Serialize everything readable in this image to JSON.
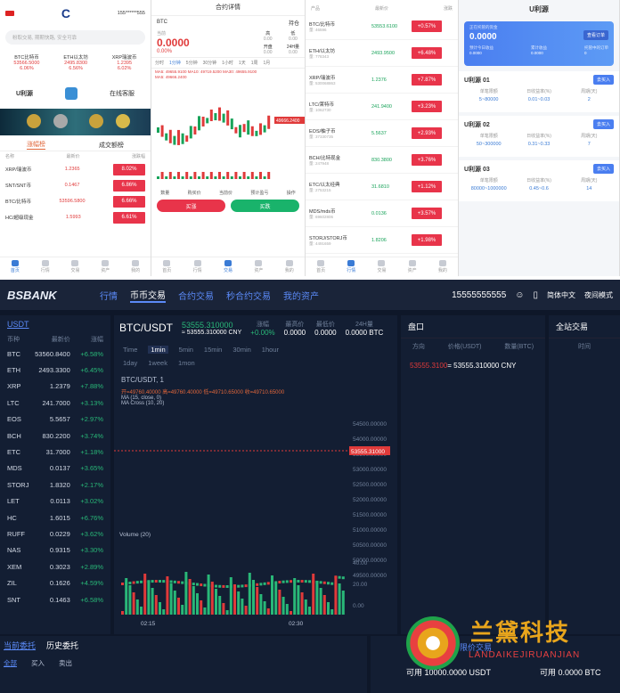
{
  "p1": {
    "logo": "C",
    "phone": "155******555",
    "search": "粉取交易, 期期快路, 安全可靠",
    "ticker": [
      {
        "name": "BTC比特币",
        "price": "53566.5000",
        "chg": "6.06%"
      },
      {
        "name": "ETH以太坊",
        "price": "2495.8300",
        "chg": "6.56%"
      },
      {
        "name": "XRP瑞波币",
        "price": "1.2395",
        "chg": "6.02%"
      }
    ],
    "u_label": "U利源",
    "service": "在线客服",
    "tab_up": "涨幅榜",
    "tab_vol": "成交额榜",
    "col_name": "名称",
    "col_price": "最新价",
    "col_chg": "涨跌幅",
    "rows": [
      {
        "n": "XRP/瑞波币",
        "p": "1.2365",
        "c": "8.02%"
      },
      {
        "n": "SNT/SNT币",
        "p": "0.1467",
        "c": "6.86%"
      },
      {
        "n": "BTC/比特币",
        "p": "53596.5800",
        "c": "6.66%"
      },
      {
        "n": "HC/超级现金",
        "p": "1.5993",
        "c": "6.61%"
      }
    ],
    "tabs": [
      "首页",
      "行情",
      "交易",
      "资产",
      "我的"
    ]
  },
  "p2": {
    "title": "合约详情",
    "sym": "BTC",
    "follow": "持仓",
    "last_label": "当前",
    "price": "0.0000",
    "chg": "0.00%",
    "high_l": "高",
    "high": "0.00",
    "low_l": "低",
    "low": "0.00",
    "open_l": "开盘",
    "open": "0.00",
    "vol_l": "24H量",
    "vol": "0.00",
    "intervals": [
      "分时",
      "1分钟",
      "5分钟",
      "30分钟",
      "1小时",
      "1天",
      "1周",
      "1月"
    ],
    "ma": "MA5: 49655.9100  MA10: 49719.5200  MA30: 49655.9100",
    "ma2": "MA5: 49666.2400",
    "stats": [
      "数量",
      "购买价",
      "当前价",
      "预计盈亏",
      "操作"
    ],
    "buy": "买涨",
    "sell": "买跌",
    "cur_price": "49666.2400"
  },
  "p3": {
    "h_prod": "产品",
    "h_price": "最新价",
    "h_chg": "涨跌",
    "rows": [
      {
        "n": "BTC/比特币",
        "v": "量: 46596",
        "p": "53553.6100",
        "c": "+0.57%"
      },
      {
        "n": "ETH/以太坊",
        "v": "量: 778343",
        "p": "2493.9500",
        "c": "+6.48%"
      },
      {
        "n": "XRP/瑞波币",
        "v": "量: 530068863",
        "p": "1.2376",
        "c": "+7.87%"
      },
      {
        "n": "LTC/莱特币",
        "v": "量: 1062730",
        "p": "241.9400",
        "c": "+3.23%"
      },
      {
        "n": "EOS/柚子币",
        "v": "量: 37330735",
        "p": "5.5637",
        "c": "+2.93%"
      },
      {
        "n": "BCH/比特现金",
        "v": "量: 247948",
        "p": "830.3800",
        "c": "+3.76%"
      },
      {
        "n": "ETC/以太经典",
        "v": "量: 2753215",
        "p": "31.6810",
        "c": "+1.12%"
      },
      {
        "n": "MDS/mds币",
        "v": "量: 69602806",
        "p": "0.0136",
        "c": "+3.57%"
      },
      {
        "n": "STORJ/STORJ币",
        "v": "量: 4491659",
        "p": "1.8206",
        "c": "+1.98%"
      },
      {
        "n": "LET/领导链",
        "v": "量: 124325759",
        "p": "0.0112",
        "c": "+2.44%"
      }
    ]
  },
  "p4": {
    "title": "U利源",
    "card_lbl": "正在托管的资金",
    "card_val": "0.0000",
    "card_btn": "查看订单",
    "s1_l": "预计今日收益",
    "s1": "0.0000",
    "s2_l": "累计收益",
    "s2": "0.0000",
    "s3_l": "托管中的订单",
    "s3": "0",
    "items": [
      {
        "t": "U利源 01",
        "btn": "去买入",
        "g": [
          "单笔限额",
          "日收益率(%)",
          "周期(天)"
        ],
        "v": [
          "5~80000",
          "0.01~0.03",
          "2"
        ]
      },
      {
        "t": "U利源 02",
        "btn": "去买入",
        "g": [
          "单笔限额",
          "日收益率(%)",
          "周期(天)"
        ],
        "v": [
          "50~300000",
          "0.31~0.33",
          "7"
        ]
      },
      {
        "t": "U利源 03",
        "btn": "去买入",
        "g": [
          "单笔限额",
          "日收益率(%)",
          "周期(天)"
        ],
        "v": [
          "80000~1000000",
          "0.45~0.6",
          "14"
        ]
      }
    ]
  },
  "desk": {
    "logo": "BSBANK",
    "nav": [
      "行情",
      "币币交易",
      "合约交易",
      "秒合约交易",
      "我的资产"
    ],
    "phone": "15555555555",
    "lang": "简体中文",
    "mode": "夜间模式",
    "left_title": "USDT",
    "lh": [
      "币种",
      "最新价",
      "涨幅"
    ],
    "list": [
      {
        "s": "BTC",
        "p": "53560.8400",
        "c": "+6.58%"
      },
      {
        "s": "ETH",
        "p": "2493.3300",
        "c": "+6.45%"
      },
      {
        "s": "XRP",
        "p": "1.2379",
        "c": "+7.88%"
      },
      {
        "s": "LTC",
        "p": "241.7000",
        "c": "+3.13%"
      },
      {
        "s": "EOS",
        "p": "5.5657",
        "c": "+2.97%"
      },
      {
        "s": "BCH",
        "p": "830.2200",
        "c": "+3.74%"
      },
      {
        "s": "ETC",
        "p": "31.7000",
        "c": "+1.18%"
      },
      {
        "s": "MDS",
        "p": "0.0137",
        "c": "+3.65%"
      },
      {
        "s": "STORJ",
        "p": "1.8320",
        "c": "+2.17%"
      },
      {
        "s": "LET",
        "p": "0.0113",
        "c": "+3.02%"
      },
      {
        "s": "HC",
        "p": "1.6015",
        "c": "+6.76%"
      },
      {
        "s": "RUFF",
        "p": "0.0229",
        "c": "+3.62%"
      },
      {
        "s": "NAS",
        "p": "0.9315",
        "c": "+3.30%"
      },
      {
        "s": "XEM",
        "p": "0.3023",
        "c": "+2.89%"
      },
      {
        "s": "ZIL",
        "p": "0.1626",
        "c": "+4.59%"
      },
      {
        "s": "SNT",
        "p": "0.1463",
        "c": "+6.58%"
      }
    ],
    "pair": "BTC/USDT",
    "price": "53555.310000",
    "cny": "≈ 53555.310000 CNY",
    "chg_l": "涨幅",
    "chg": "+0.00%",
    "hi_l": "最高价",
    "hi": "0.0000",
    "lo_l": "最低价",
    "lo": "0.0000",
    "vol_l": "24H量",
    "vol": "0.0000 BTC",
    "iv1": [
      "Time",
      "1min",
      "5min",
      "15min",
      "30min",
      "1hour"
    ],
    "iv2": [
      "1day",
      "1week",
      "1mon"
    ],
    "chart_title": "BTC/USDT, 1",
    "ohlc": "开=49760.40000 高=49760.40000 低=49710.65000 收=49710.65000",
    "ma": "MA (15, close, 0)",
    "macross": "MA Cross (10, 20)",
    "vol_lbl": "Volume (20)",
    "cur": "53555.31000",
    "yticks": [
      "54500.00000",
      "54000.00000",
      "53500.00000",
      "53000.00000",
      "52500.00000",
      "52000.00000",
      "51500.00000",
      "51000.00000",
      "50500.00000",
      "50000.00000",
      "49500.00000"
    ],
    "vticks": [
      "40.00",
      "20.00",
      "0.00"
    ],
    "xticks": [
      "02:15",
      "02:30"
    ],
    "book": "盘口",
    "book_cols": [
      "方向",
      "价格(USDT)",
      "数量(BTC)"
    ],
    "book_price": "53555.3100",
    "book_cny": "= 53555.310000 CNY",
    "trades": "全站交易",
    "trades_col": "时间",
    "btabs": [
      "当前委托",
      "历史委托"
    ],
    "btabs2": [
      "全部",
      "买入",
      "卖出"
    ],
    "limit": "限价交易",
    "avail1": "可用 10000.0000 USDT",
    "avail2": "可用 0.0000 BTC"
  },
  "wm": {
    "cn": "兰黛科技",
    "en": "LANDAIKEJIRUANJIAN"
  }
}
